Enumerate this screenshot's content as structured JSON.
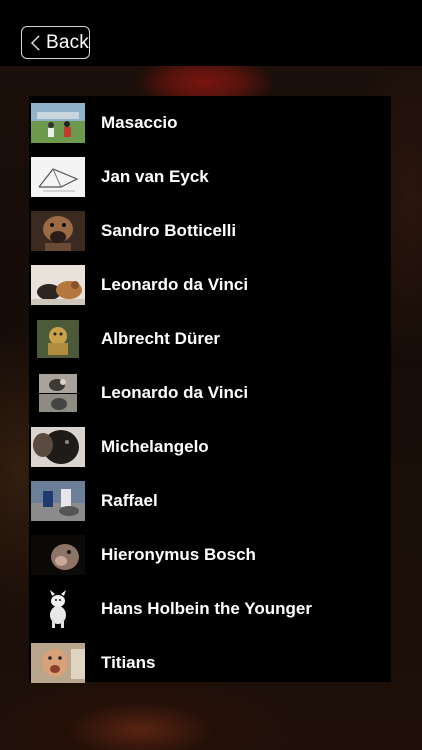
{
  "nav": {
    "back_label": "Back",
    "back_icon": "chevron-left-icon"
  },
  "artists": [
    {
      "name": "Masaccio"
    },
    {
      "name": "Jan van Eyck"
    },
    {
      "name": "Sandro Botticelli"
    },
    {
      "name": "Leonardo da Vinci"
    },
    {
      "name": "Albrecht Dürer"
    },
    {
      "name": "Leonardo da Vinci"
    },
    {
      "name": "Michelangelo"
    },
    {
      "name": "Raffael"
    },
    {
      "name": "Hieronymus Bosch"
    },
    {
      "name": "Hans Holbein the Younger"
    },
    {
      "name": "Titians"
    }
  ]
}
